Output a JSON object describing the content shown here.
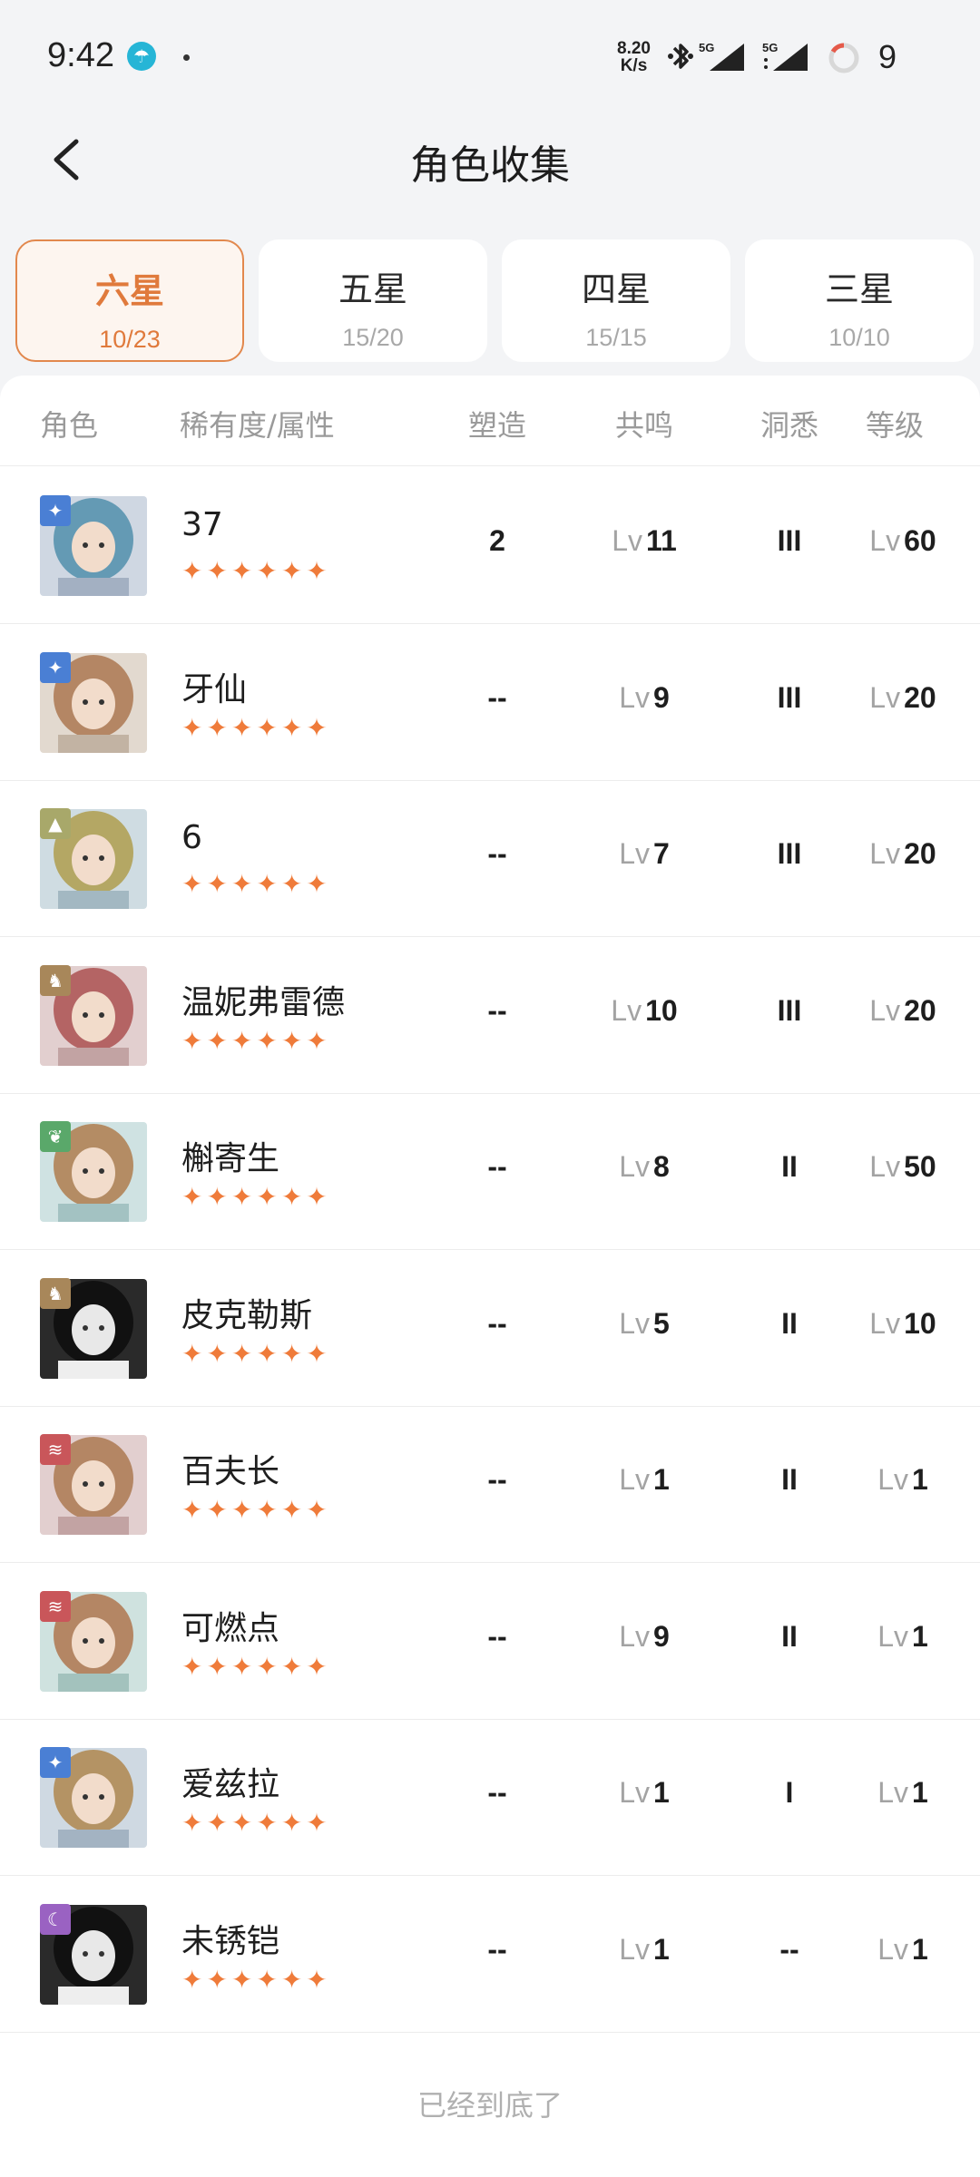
{
  "status_bar": {
    "time": "9:42",
    "speed_value": "8.20",
    "speed_unit": "K/s",
    "battery": "9"
  },
  "header": {
    "title": "角色收集"
  },
  "tabs": [
    {
      "label": "六星",
      "count": "10/23",
      "active": true
    },
    {
      "label": "五星",
      "count": "15/20",
      "active": false
    },
    {
      "label": "四星",
      "count": "15/15",
      "active": false
    },
    {
      "label": "三星",
      "count": "10/10",
      "active": false
    }
  ],
  "columns": {
    "character": "角色",
    "rarity_attr": "稀有度/属性",
    "mold": "塑造",
    "resonance": "共鸣",
    "insight": "洞悉",
    "level": "等级"
  },
  "level_prefix": "Lv",
  "stars": "✦✦✦✦✦✦",
  "characters": [
    {
      "name": "37",
      "mold": "2",
      "resonance": "11",
      "insight": "III",
      "level": "60",
      "element_icon": "star-icon",
      "element_color": "#4a7fd4"
    },
    {
      "name": "牙仙",
      "mold": "--",
      "resonance": "9",
      "insight": "III",
      "level": "20",
      "element_icon": "star-icon",
      "element_color": "#4a7fd4"
    },
    {
      "name": "6",
      "mold": "--",
      "resonance": "7",
      "insight": "III",
      "level": "20",
      "element_icon": "pyramid-icon",
      "element_color": "#a8a86a"
    },
    {
      "name": "温妮弗雷德",
      "mold": "--",
      "resonance": "10",
      "insight": "III",
      "level": "20",
      "element_icon": "beast-icon",
      "element_color": "#a8875a"
    },
    {
      "name": "槲寄生",
      "mold": "--",
      "resonance": "8",
      "insight": "II",
      "level": "50",
      "element_icon": "leaf-icon",
      "element_color": "#5aa86a"
    },
    {
      "name": "皮克勒斯",
      "mold": "--",
      "resonance": "5",
      "insight": "II",
      "level": "10",
      "element_icon": "beast-icon",
      "element_color": "#a8875a"
    },
    {
      "name": "百夫长",
      "mold": "--",
      "resonance": "1",
      "insight": "II",
      "level": "1",
      "element_icon": "wave-icon",
      "element_color": "#c9565a"
    },
    {
      "name": "可燃点",
      "mold": "--",
      "resonance": "9",
      "insight": "II",
      "level": "1",
      "element_icon": "wave-icon",
      "element_color": "#c9565a"
    },
    {
      "name": "爱兹拉",
      "mold": "--",
      "resonance": "1",
      "insight": "I",
      "level": "1",
      "element_icon": "star-icon",
      "element_color": "#4a7fd4"
    },
    {
      "name": "未锈铠",
      "mold": "--",
      "resonance": "1",
      "insight": "--",
      "level": "1",
      "element_icon": "moon-icon",
      "element_color": "#9a62c2"
    }
  ],
  "footer": "已经到底了"
}
